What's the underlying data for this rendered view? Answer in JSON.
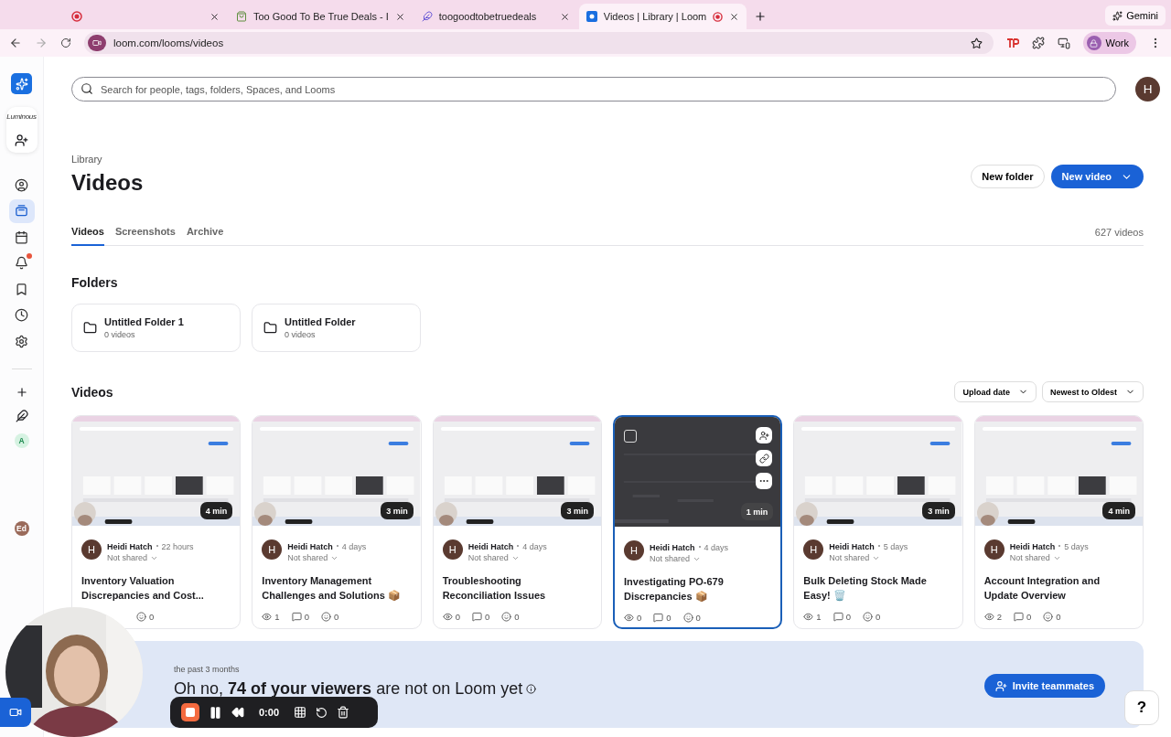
{
  "browser": {
    "tabs": [
      {
        "selected": false,
        "recording": false
      },
      {
        "title": "Too Good To Be True Deals - I",
        "selected": false,
        "recording": false
      },
      {
        "title": "toogoodtobetruedeals",
        "selected": false,
        "recording": false
      },
      {
        "title": "Videos | Library | Loom",
        "selected": true,
        "recording": true
      }
    ],
    "gemini": "Gemini",
    "address": "loom.com/looms/videos",
    "profile": "Work"
  },
  "sidebar": {
    "workspace_logo": "Luminous",
    "items": [
      {
        "kind": "profile",
        "selected": false,
        "unread": false
      },
      {
        "kind": "library",
        "selected": true,
        "unread": false
      },
      {
        "kind": "calendar",
        "selected": false,
        "unread": false
      },
      {
        "kind": "notifications",
        "selected": false,
        "unread": true
      },
      {
        "kind": "bookmarks",
        "selected": false,
        "unread": false
      },
      {
        "kind": "history",
        "selected": false,
        "unread": false
      },
      {
        "kind": "settings",
        "selected": false,
        "unread": false
      }
    ],
    "space_avatar": "A",
    "user_avatar": "Ed"
  },
  "search": {
    "placeholder": "Search for people, tags, folders, Spaces, and Looms"
  },
  "user_avatar": "H",
  "header": {
    "breadcrumb": "Library",
    "title": "Videos",
    "new_folder": "New folder",
    "new_video": "New video"
  },
  "tabs": [
    {
      "label": "Videos",
      "selected": true
    },
    {
      "label": "Screenshots",
      "selected": false
    },
    {
      "label": "Archive",
      "selected": false
    }
  ],
  "count": "627 videos",
  "folders": {
    "heading": "Folders",
    "items": [
      {
        "name": "Untitled Folder 1",
        "count": "0 videos"
      },
      {
        "name": "Untitled Folder",
        "count": "0 videos"
      }
    ]
  },
  "videos": {
    "heading": "Videos",
    "filters": [
      "Upload date",
      "Newest to Oldest"
    ],
    "items": [
      {
        "avatar": "H",
        "author": "Heidi Hatch",
        "time": "22 hours",
        "sharing": "Not shared",
        "title": "Inventory Valuation Discrepancies and Cost...",
        "duration": "4 min",
        "hovered": false,
        "checked": false,
        "stats": [
          {
            "kind": "reactions",
            "value": "0"
          }
        ]
      },
      {
        "avatar": "H",
        "author": "Heidi Hatch",
        "time": "4 days",
        "sharing": "Not shared",
        "title": "Inventory Management Challenges and Solutions 📦",
        "duration": "3 min",
        "hovered": false,
        "checked": false,
        "stats": [
          {
            "kind": "views",
            "value": "1"
          },
          {
            "kind": "comments",
            "value": "0"
          },
          {
            "kind": "reactions",
            "value": "0"
          }
        ]
      },
      {
        "avatar": "H",
        "author": "Heidi Hatch",
        "time": "4 days",
        "sharing": "Not shared",
        "title": "Troubleshooting Reconciliation Issues",
        "duration": "3 min",
        "hovered": false,
        "checked": false,
        "stats": [
          {
            "kind": "views",
            "value": "0"
          },
          {
            "kind": "comments",
            "value": "0"
          },
          {
            "kind": "reactions",
            "value": "0"
          }
        ]
      },
      {
        "avatar": "H",
        "author": "Heidi Hatch",
        "time": "4 days",
        "sharing": "Not shared",
        "title": "Investigating PO-679 Discrepancies 📦",
        "duration": "1 min",
        "hovered": true,
        "checked": false,
        "stats": [
          {
            "kind": "views",
            "value": "0"
          },
          {
            "kind": "comments",
            "value": "0"
          },
          {
            "kind": "reactions",
            "value": "0"
          }
        ]
      },
      {
        "avatar": "H",
        "author": "Heidi Hatch",
        "time": "5 days",
        "sharing": "Not shared",
        "title": "Bulk Deleting Stock Made Easy! 🗑️",
        "duration": "3 min",
        "hovered": false,
        "checked": false,
        "stats": [
          {
            "kind": "views",
            "value": "1"
          },
          {
            "kind": "comments",
            "value": "0"
          },
          {
            "kind": "reactions",
            "value": "0"
          }
        ]
      },
      {
        "avatar": "H",
        "author": "Heidi Hatch",
        "time": "5 days",
        "sharing": "Not shared",
        "title": "Account Integration and Update Overview",
        "duration": "4 min",
        "hovered": false,
        "checked": false,
        "stats": [
          {
            "kind": "views",
            "value": "2"
          },
          {
            "kind": "comments",
            "value": "0"
          },
          {
            "kind": "reactions",
            "value": "0"
          }
        ]
      }
    ]
  },
  "banner": {
    "period": "the past 3 months",
    "message": "Oh no, **74 of your viewers** are not on Loom yet",
    "button": "Invite teammates"
  },
  "recorder": {
    "time": "0:00"
  },
  "help": "?"
}
